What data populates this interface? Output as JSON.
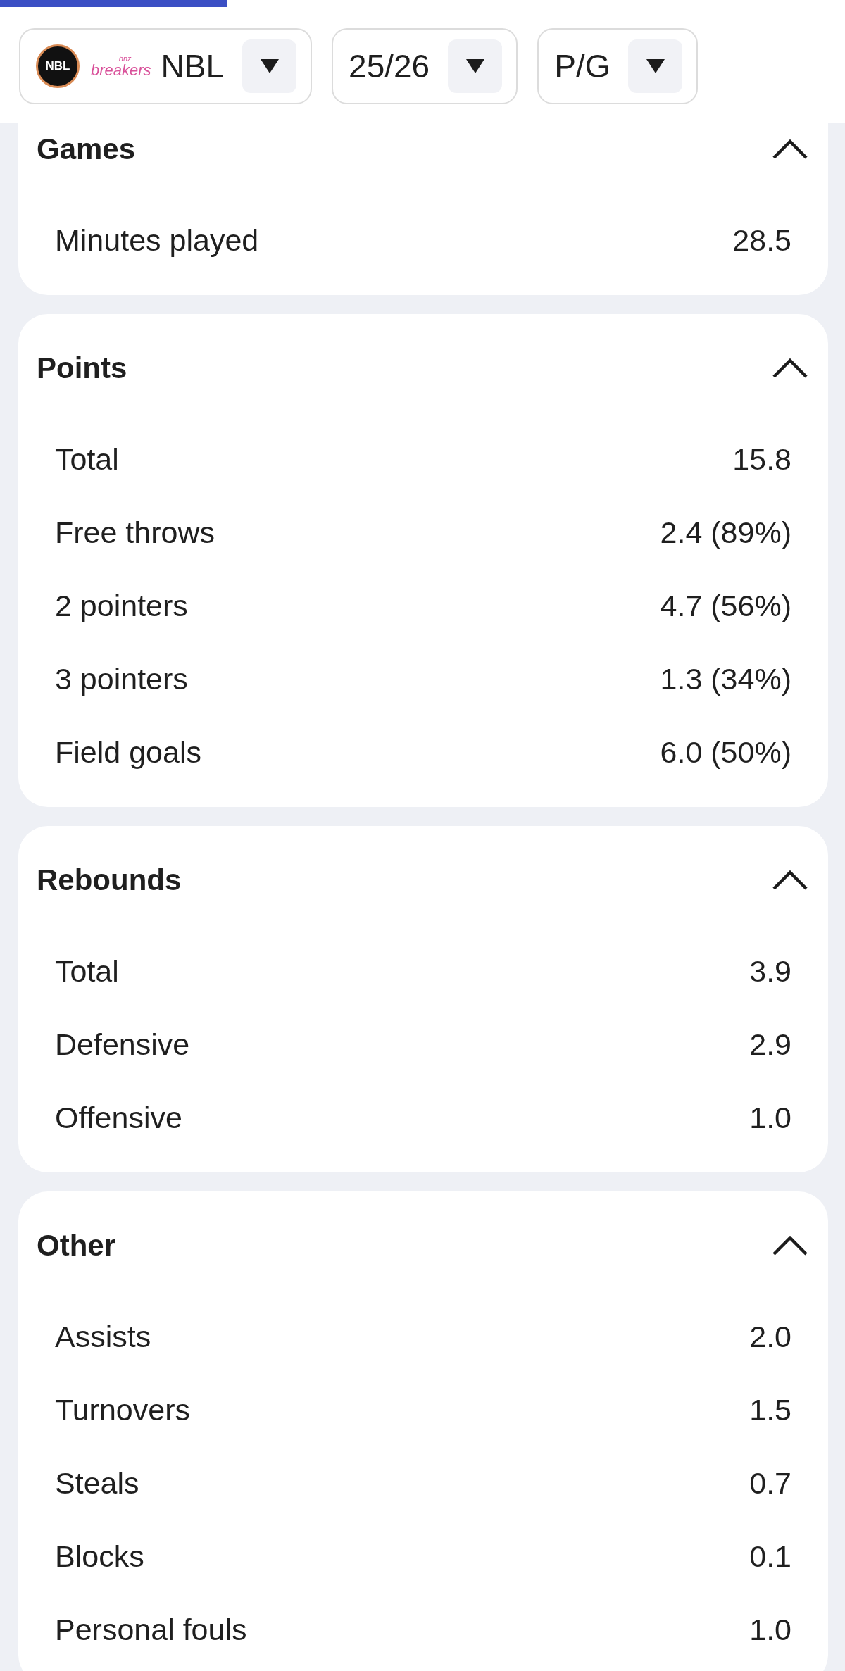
{
  "filters": [
    {
      "kind": "league",
      "badge": "NBL",
      "logo_small": "bnz",
      "logo_text": "breakers",
      "label": "NBL"
    },
    {
      "kind": "plain",
      "label": "25/26"
    },
    {
      "kind": "plain",
      "label": "P/G"
    }
  ],
  "sections": [
    {
      "title": "Games",
      "expanded": true,
      "rows": [
        {
          "label": "Minutes played",
          "value": "28.5"
        }
      ]
    },
    {
      "title": "Points",
      "expanded": true,
      "rows": [
        {
          "label": "Total",
          "value": "15.8"
        },
        {
          "label": "Free throws",
          "value": "2.4 (89%)"
        },
        {
          "label": "2 pointers",
          "value": "4.7 (56%)"
        },
        {
          "label": "3 pointers",
          "value": "1.3 (34%)"
        },
        {
          "label": "Field goals",
          "value": "6.0 (50%)"
        }
      ]
    },
    {
      "title": "Rebounds",
      "expanded": true,
      "rows": [
        {
          "label": "Total",
          "value": "3.9"
        },
        {
          "label": "Defensive",
          "value": "2.9"
        },
        {
          "label": "Offensive",
          "value": "1.0"
        }
      ]
    },
    {
      "title": "Other",
      "expanded": true,
      "rows": [
        {
          "label": "Assists",
          "value": "2.0"
        },
        {
          "label": "Turnovers",
          "value": "1.5"
        },
        {
          "label": "Steals",
          "value": "0.7"
        },
        {
          "label": "Blocks",
          "value": "0.1"
        },
        {
          "label": "Personal fouls",
          "value": "1.0"
        }
      ]
    }
  ]
}
